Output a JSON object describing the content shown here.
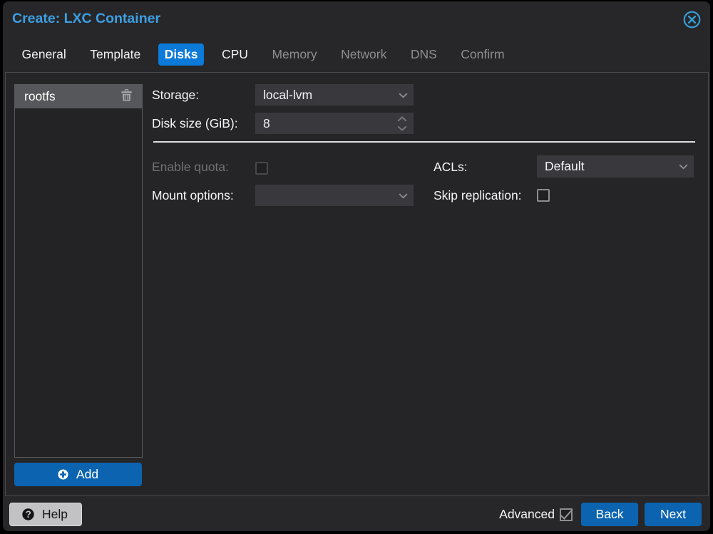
{
  "window": {
    "title": "Create: LXC Container",
    "tabs": [
      {
        "label": "General",
        "state_class": ""
      },
      {
        "label": "Template",
        "state_class": ""
      },
      {
        "label": "Disks",
        "state_class": "active"
      },
      {
        "label": "CPU",
        "state_class": ""
      },
      {
        "label": "Memory",
        "state_class": "disabled"
      },
      {
        "label": "Network",
        "state_class": "disabled"
      },
      {
        "label": "DNS",
        "state_class": "disabled"
      },
      {
        "label": "Confirm",
        "state_class": "disabled"
      }
    ]
  },
  "sidebar": {
    "items": [
      {
        "label": "rootfs",
        "selected": true
      }
    ],
    "add_button": {
      "label": "Add"
    }
  },
  "form": {
    "storage": {
      "label": "Storage:",
      "value": "local-lvm",
      "type": "combobox"
    },
    "disk_size": {
      "label": "Disk size (GiB):",
      "value": "8",
      "type": "spinner"
    },
    "enable_quota": {
      "label": "Enable quota:",
      "checked": false,
      "disabled": true
    },
    "acls": {
      "label": "ACLs:",
      "value": "Default",
      "type": "combobox"
    },
    "mount_options": {
      "label": "Mount options:",
      "value": "",
      "type": "combobox"
    },
    "skip_replication": {
      "label": "Skip replication:",
      "checked": false
    }
  },
  "footer": {
    "help_button": {
      "label": "Help"
    },
    "advanced": {
      "label": "Advanced",
      "checked": true
    },
    "back_button": "Back",
    "next_button": "Next"
  },
  "colors": {
    "win-bg": "#27272a",
    "body-bg": "#252528",
    "panel-border": "#4a4a4d",
    "list-bg": "#232326",
    "list-border": "#59595d",
    "sel-bg": "#56575b",
    "field-bg": "#39393d",
    "field-text": "#f2f2f4",
    "label": "#f5f5f7",
    "disabled-label": "#717174",
    "disabled-tab": "#8e8e91",
    "sep": "#dededf",
    "title-blue": "#3d9fe3",
    "tab-blue": "#0b7ad8",
    "btn-blue": "#0c64b0",
    "help-bg": "#c2c2c4",
    "help-border": "#d9d9da",
    "help-text": "#18181b",
    "close-blue": "#35a2da",
    "chevron": "#8f8f92",
    "spin-chevron": "#7a7a7e",
    "trash": "#a3a4a7",
    "cb-border": "#8e8e91",
    "cb-border-dis": "#48484b",
    "cb-bg": "#202023",
    "check": "#98989b"
  }
}
